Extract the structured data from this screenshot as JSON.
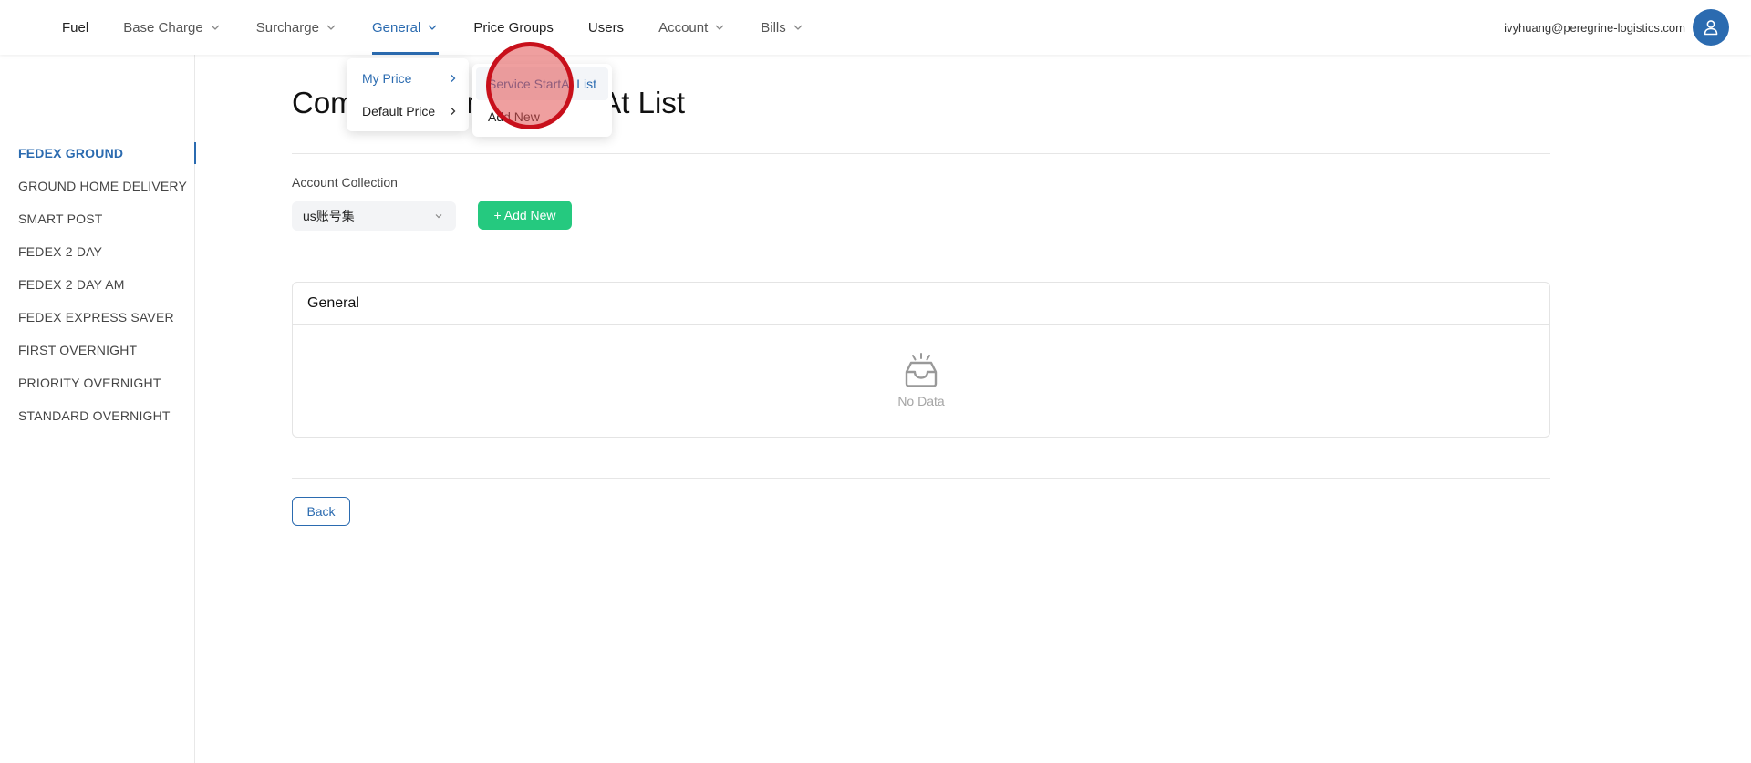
{
  "nav": {
    "items": [
      {
        "label": "Fuel",
        "dropdown": false
      },
      {
        "label": "Base Charge",
        "dropdown": true
      },
      {
        "label": "Surcharge",
        "dropdown": true
      },
      {
        "label": "General",
        "dropdown": true,
        "active": true
      },
      {
        "label": "Price Groups",
        "dropdown": false
      },
      {
        "label": "Users",
        "dropdown": false
      },
      {
        "label": "Account",
        "dropdown": true
      },
      {
        "label": "Bills",
        "dropdown": true
      }
    ]
  },
  "user": {
    "email": "ivyhuang@peregrine-logistics.com",
    "avatar_icon": "user-icon"
  },
  "sidebar": {
    "items": [
      {
        "label": "FEDEX GROUND",
        "active": true
      },
      {
        "label": "GROUND HOME DELIVERY"
      },
      {
        "label": "SMART POST"
      },
      {
        "label": "FEDEX 2 DAY"
      },
      {
        "label": "FEDEX 2 DAY AM"
      },
      {
        "label": "FEDEX EXPRESS SAVER"
      },
      {
        "label": "FIRST OVERNIGHT"
      },
      {
        "label": "PRIORITY OVERNIGHT"
      },
      {
        "label": "STANDARD OVERNIGHT"
      }
    ]
  },
  "main": {
    "title": "Company Service StartAt List",
    "account_collection_label": "Account Collection",
    "account_collection_value": "us账号集",
    "add_new_label": "+ Add New",
    "card_title": "General",
    "empty_text": "No Data",
    "empty_icon": "inbox-icon",
    "back_label": "Back"
  },
  "general_menu": {
    "items": [
      {
        "label": "My Price",
        "selected": true
      },
      {
        "label": "Default Price"
      }
    ],
    "submenu": [
      {
        "label": "Service StartAt List",
        "hover": true
      },
      {
        "label": "Add New"
      }
    ]
  },
  "colors": {
    "accent": "#2b6bb0",
    "success": "#25c97f",
    "click_marker": "#c8101b"
  }
}
